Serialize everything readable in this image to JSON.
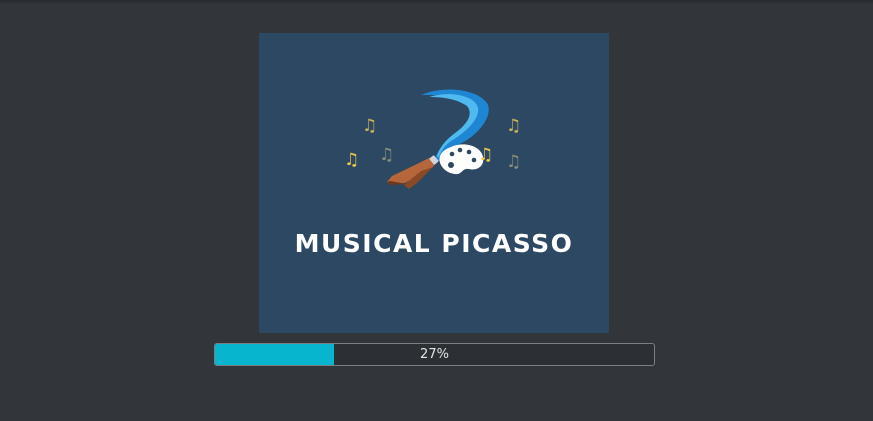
{
  "splash": {
    "title": "MUSICAL PICASSO",
    "icons": [
      "music-note-icon",
      "paintbrush-icon",
      "palette-icon"
    ]
  },
  "progress": {
    "value": 0.27,
    "label": "27%",
    "fill_color": "#08b5cf"
  },
  "colors": {
    "background": "#32363a",
    "splash_bg": "#2c4862",
    "note_yellow": "#f2c94c",
    "note_gray": "#8a8f7a",
    "brush_blue": "#2f9fe6"
  }
}
